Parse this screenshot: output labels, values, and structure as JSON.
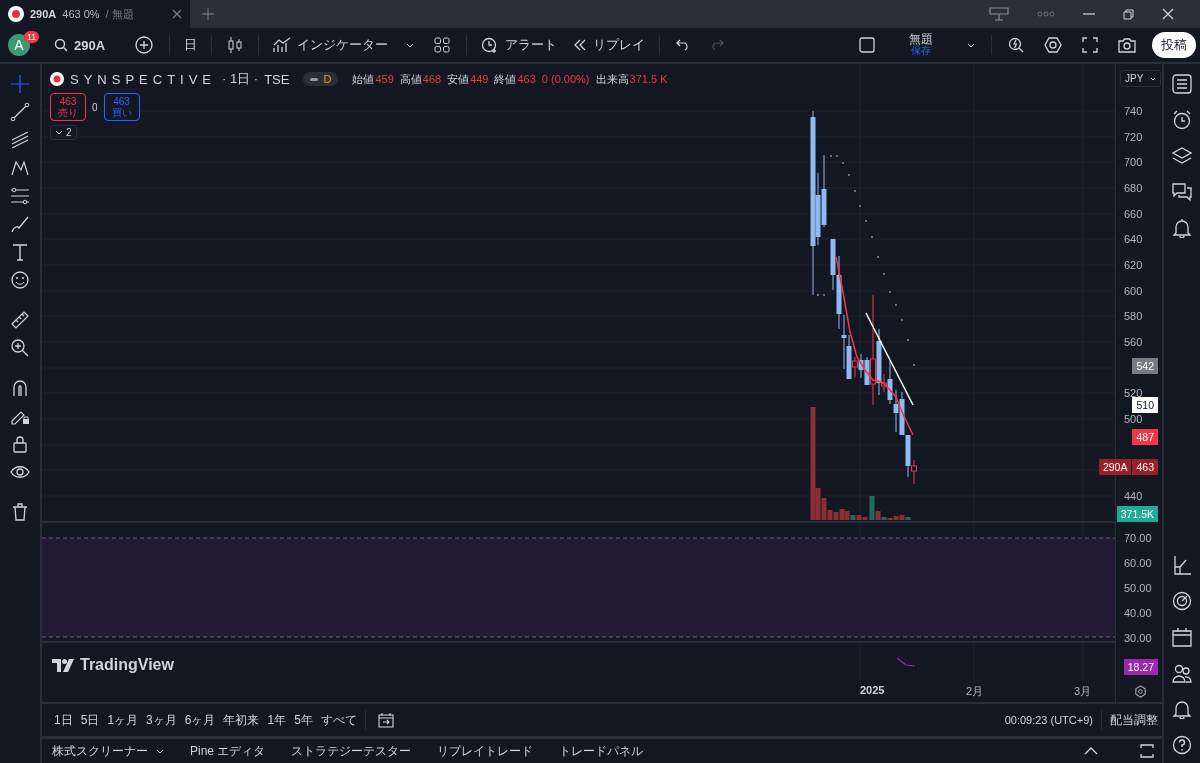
{
  "tab": {
    "symbol": "290A",
    "quote": "463 0%",
    "title": "/ 無題"
  },
  "toolbar": {
    "avatar": "A",
    "notifications": "11",
    "symbol": "290A",
    "interval": "日",
    "indicators": "インジケーター",
    "alert": "アラート",
    "replay": "リプレイ",
    "layout_name": "無題",
    "layout_status": "保存",
    "publish": "投稿"
  },
  "legend": {
    "name": "SYNSPECTIVE",
    "interval": "· 1日 ·",
    "exchange": "TSE",
    "badge": "D",
    "ohlc": [
      {
        "label": "始値",
        "value": "459"
      },
      {
        "label": "高値",
        "value": "468"
      },
      {
        "label": "安値",
        "value": "449"
      },
      {
        "label": "終値",
        "value": "463"
      }
    ],
    "change": "0 (0.00%)",
    "volume_label": "出来高",
    "volume_value": "371.5 K"
  },
  "trade": {
    "sell_price": "463",
    "sell_label": "売り",
    "spread": "0",
    "buy_price": "463",
    "buy_label": "買い"
  },
  "collapse_count": "2",
  "currency": "JPY",
  "price_axis": {
    "ticks": [
      "740",
      "720",
      "700",
      "680",
      "660",
      "640",
      "620",
      "600",
      "580",
      "560",
      "520",
      "500",
      "440"
    ]
  },
  "markers": [
    {
      "text": "542",
      "color": "#787b86"
    },
    {
      "text": "510",
      "color": "#ffffff"
    },
    {
      "text": "487",
      "color": "#f23645"
    },
    {
      "label": "290A",
      "text": "463",
      "color": "#9a1f27"
    },
    {
      "text": "371.5K",
      "color": "#22ab94"
    }
  ],
  "rsi_axis": {
    "ticks": [
      "70.00",
      "60.00",
      "50.00",
      "40.00",
      "30.00"
    ]
  },
  "lower_marker": {
    "text": "18.27",
    "color": "#9c27b0"
  },
  "logo": "TradingView",
  "time_axis": [
    {
      "label": "2025",
      "bold": true
    },
    {
      "label": "2月",
      "bold": false
    },
    {
      "label": "3月",
      "bold": false
    }
  ],
  "periods": [
    "1日",
    "5日",
    "1ヶ月",
    "3ヶ月",
    "6ヶ月",
    "年初来",
    "1年",
    "5年",
    "すべて"
  ],
  "clock": "00:09:23 (UTC+9)",
  "adjust": "配当調整",
  "bottom_tabs": [
    {
      "label": "株式スクリーナー",
      "dropdown": true
    },
    {
      "label": "Pine エディタ",
      "dropdown": false
    },
    {
      "label": "ストラテジーテスター",
      "dropdown": false
    },
    {
      "label": "リプレイトレード",
      "dropdown": false
    },
    {
      "label": "トレードパネル",
      "dropdown": false
    }
  ]
}
